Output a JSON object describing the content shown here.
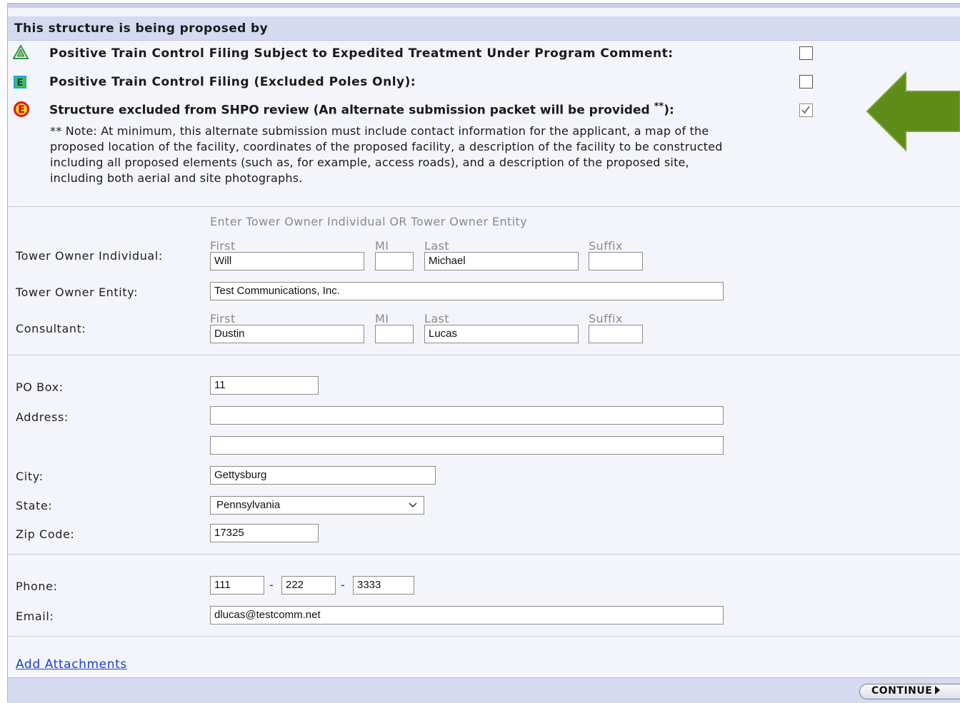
{
  "header": {
    "title": "This structure is being proposed by"
  },
  "options": [
    {
      "icon": "green-warning-triangle-icon",
      "label": "Positive Train Control Filing Subject to Expedited Treatment Under Program Comment:",
      "checked": false
    },
    {
      "icon": "blue-e-square-icon",
      "label": "Positive Train Control Filing (Excluded Poles Only):",
      "checked": false
    },
    {
      "icon": "red-e-circle-icon",
      "label_bold": "Structure  excluded from SHPO review (An alternate submission packet will be provided",
      "label_sup": "**",
      "label_end": "):",
      "checked": true
    }
  ],
  "note": {
    "marker": "**",
    "text": " Note: At minimum, this alternate submission must include contact information for the applicant, a map of the proposed location of the facility, coordinates of the proposed facility, a description of the facility to be constructed including all proposed elements (such as, for example, access roads), and a description of the proposed site, including both aerial and site photographs."
  },
  "owner": {
    "instruction": "Enter Tower Owner Individual OR Tower Owner Entity",
    "sub_first": "First",
    "sub_mi": "MI",
    "sub_last": "Last",
    "sub_suffix": "Suffix",
    "individual_label": "Tower Owner Individual:",
    "individual_first": "Will",
    "individual_mi": "",
    "individual_last": "Michael",
    "individual_suffix": "",
    "entity_label": "Tower Owner Entity:",
    "entity_value": "Test Communications, Inc.",
    "consultant_label": "Consultant:",
    "consultant_first": "Dustin",
    "consultant_mi": "",
    "consultant_last": "Lucas",
    "consultant_suffix": ""
  },
  "address": {
    "pobox_label": "PO Box:",
    "pobox_value": "11",
    "address_label": "Address:",
    "address_line1": "",
    "address_line2": "",
    "city_label": "City:",
    "city_value": "Gettysburg",
    "state_label": "State:",
    "state_value": "Pennsylvania",
    "zip_label": "Zip Code:",
    "zip_value": "17325"
  },
  "contact": {
    "phone_label": "Phone:",
    "phone_area": "111",
    "phone_prefix": "222",
    "phone_line": "3333",
    "phone_sep": "-",
    "email_label": "Email:",
    "email_value": "dlucas@testcomm.net"
  },
  "links": {
    "attachments": "Add Attachments"
  },
  "footer": {
    "continue_label": "CONTINUE"
  },
  "colors": {
    "arrow": "#5f8c19",
    "header_bg": "#d6daf0",
    "link": "#1a3fd0"
  }
}
